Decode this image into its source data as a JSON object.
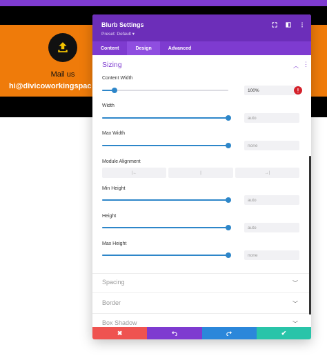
{
  "background": {
    "blurb_title": "Mail us",
    "blurb_email": "hi@divicoworkingspac",
    "icon": "upload-icon"
  },
  "modal": {
    "title": "Blurb Settings",
    "preset": "Preset: Default ▾",
    "header_icons": [
      "fullscreen-icon",
      "split-view-icon",
      "more-options-icon"
    ],
    "tabs": [
      {
        "label": "Content",
        "active": false
      },
      {
        "label": "Design",
        "active": true
      },
      {
        "label": "Advanced",
        "active": false
      }
    ]
  },
  "sizing": {
    "title": "Sizing",
    "fields": [
      {
        "label": "Content Width",
        "value": "100%",
        "slider": 0.1,
        "placeholder": false
      },
      {
        "label": "Width",
        "value": "auto",
        "slider": 1.0,
        "placeholder": true
      },
      {
        "label": "Max Width",
        "value": "none",
        "slider": 1.0,
        "placeholder": true
      },
      {
        "label": "Min Height",
        "value": "auto",
        "slider": 1.0,
        "placeholder": true
      },
      {
        "label": "Height",
        "value": "auto",
        "slider": 1.0,
        "placeholder": true
      },
      {
        "label": "Max Height",
        "value": "none",
        "slider": 1.0,
        "placeholder": true
      }
    ],
    "alignment_label": "Module Alignment",
    "alignment_options": [
      "|←",
      "|",
      "→|"
    ],
    "warning_icon": "!"
  },
  "collapsed_sections": [
    "Spacing",
    "Border",
    "Box Shadow"
  ],
  "footer": {
    "cancel": "✖",
    "undo": "undo-icon",
    "redo": "redo-icon",
    "save": "✔"
  },
  "colors": {
    "accent": "#7e3bd0",
    "header": "#6c2eb9",
    "slider": "#2d86c9",
    "cancel": "#ef5350",
    "redo": "#2b87da",
    "save": "#29c4a9",
    "page_orange": "#ef7b0a"
  }
}
